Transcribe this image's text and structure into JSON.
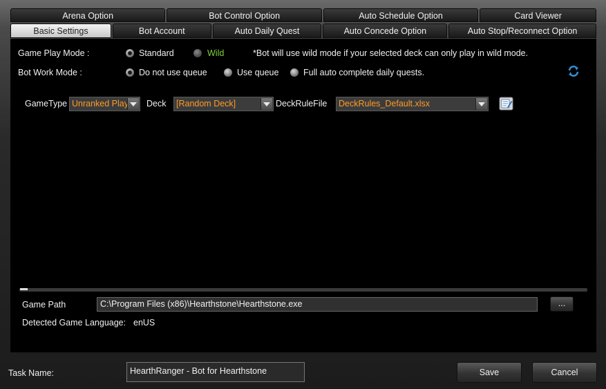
{
  "tabs": {
    "top": [
      "Arena Option",
      "Bot Control Option",
      "Auto Schedule Option",
      "Card Viewer"
    ],
    "bottom": [
      "Basic Settings",
      "Bot Account",
      "Auto Daily Quest",
      "Auto Concede Option",
      "Auto Stop/Reconnect Option"
    ],
    "selected": "Basic Settings"
  },
  "game_play_mode": {
    "label": "Game Play Mode :",
    "options": [
      "Standard",
      "Wild"
    ],
    "selected": "Standard",
    "note": "*Bot will use wild mode if  your selected deck can only play in wild mode."
  },
  "bot_work_mode": {
    "label": "Bot Work Mode :",
    "options": [
      "Do not use queue",
      "Use queue",
      "Full auto complete daily quests."
    ],
    "selected": "Do not use queue"
  },
  "selectors": {
    "gametype_label": "GameType",
    "gametype_value": "Unranked Play",
    "deck_label": "Deck",
    "deck_value": "[Random Deck]",
    "deckrule_label": "DeckRuleFile",
    "deckrule_value": "DeckRules_Default.xlsx"
  },
  "game_path": {
    "label": "Game Path",
    "value": "C:\\Program Files (x86)\\Hearthstone\\Hearthstone.exe",
    "browse_label": "..."
  },
  "language": {
    "label": "Detected Game Language:",
    "value": "enUS"
  },
  "footer": {
    "task_label": "Task Name:",
    "task_value": "HearthRanger - Bot for Hearthstone",
    "save_label": "Save",
    "cancel_label": "Cancel"
  },
  "colors": {
    "accent_orange": "#ff9a26",
    "wild_green": "#7fd13b",
    "refresh_blue": "#2e8fd8"
  },
  "icons": [
    "refresh-icon",
    "edit-file-icon"
  ]
}
